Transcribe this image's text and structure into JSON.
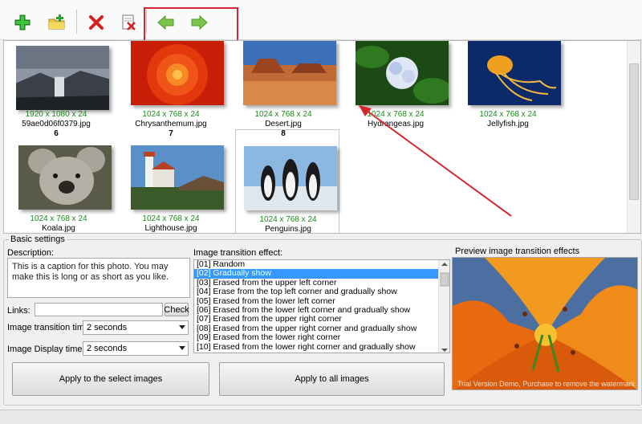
{
  "toolbar": {
    "buttons": [
      {
        "name": "add-icon"
      },
      {
        "name": "add-folder-icon"
      },
      {
        "name": "delete-icon"
      },
      {
        "name": "delete-all-icon"
      },
      {
        "name": "move-left-icon"
      },
      {
        "name": "move-right-icon"
      }
    ]
  },
  "gallery": {
    "items": [
      {
        "dims": "1920 x 1080 x 24",
        "name": "59ae0d06f0379.jpg",
        "num": "6"
      },
      {
        "dims": "1024 x 768 x 24",
        "name": "Chrysanthemum.jpg",
        "num": "7"
      },
      {
        "dims": "1024 x 768 x 24",
        "name": "Desert.jpg",
        "num": "8"
      },
      {
        "dims": "1024 x 768 x 24",
        "name": "Hydrangeas.jpg",
        "num": ""
      },
      {
        "dims": "1024 x 768 x 24",
        "name": "Jellyfish.jpg",
        "num": ""
      },
      {
        "dims": "1024 x 768 x 24",
        "name": "Koala.jpg",
        "num": ""
      },
      {
        "dims": "1024 x 768 x 24",
        "name": "Lighthouse.jpg",
        "num": ""
      },
      {
        "dims": "1024 x 768 x 24",
        "name": "Penguins.jpg",
        "num": ""
      }
    ]
  },
  "settings": {
    "legend": "Basic settings",
    "description_label": "Description:",
    "description_text": "This is a caption for this photo. You may make this is long or as short as you like.",
    "links_label": "Links:",
    "check_button": "Check",
    "transition_time_label": "Image transition time:",
    "transition_time_value": "2 seconds",
    "display_time_label": "Image Display time:",
    "display_time_value": "2 seconds",
    "apply_selected": "Apply to the select images",
    "apply_all": "Apply to all images",
    "effect_label": "Image transition effect:",
    "effects": [
      "[01] Random",
      "[02] Gradually show",
      "[03] Erased from the upper left corner",
      "[04] Erase from the top left corner and gradually show",
      "[05] Erased from the lower left corner",
      "[06] Erased from the lower left corner and gradually show",
      "[07] Erased from the upper right corner",
      "[08] Erased from the upper right corner and gradually show",
      "[09] Erased from the lower right corner",
      "[10] Erased from the lower right corner and gradually show"
    ],
    "selected_effect_index": 1,
    "preview_label": "Preview image transition effects",
    "preview_watermark": "Trial Version Demo, Purchase to remove the watermark"
  },
  "colors": {
    "highlight_box": "#d9262e",
    "dims_text": "#1a8a1a",
    "list_selection": "#3399ff"
  }
}
